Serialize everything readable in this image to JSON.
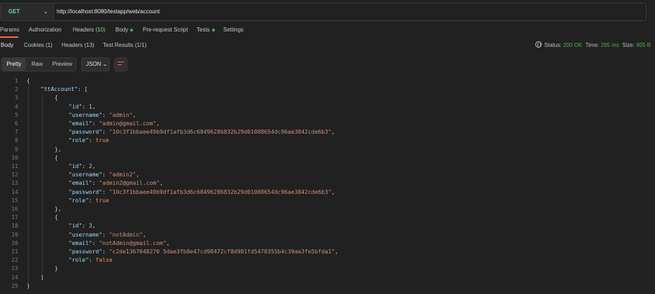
{
  "request": {
    "method": "GET",
    "url": "http://localhost:8080/testapp/web/account"
  },
  "request_tabs": [
    {
      "label": "Params",
      "count": ""
    },
    {
      "label": "Authorization",
      "count": ""
    },
    {
      "label": "Headers",
      "count": "(10)"
    },
    {
      "label": "Body",
      "count": ""
    },
    {
      "label": "Pre-request Script",
      "count": ""
    },
    {
      "label": "Tests",
      "count": ""
    },
    {
      "label": "Settings",
      "count": ""
    }
  ],
  "response_tabs": [
    {
      "label": "Body",
      "count": ""
    },
    {
      "label": "Cookies",
      "count": "(1)"
    },
    {
      "label": "Headers",
      "count": "(13)"
    },
    {
      "label": "Test Results",
      "count": "(1/1)"
    }
  ],
  "status": {
    "status_label": "Status:",
    "status_value": "200 OK",
    "time_label": "Time:",
    "time_value": "265 ms",
    "size_label": "Size:",
    "size_value": "905 B"
  },
  "view": {
    "pretty": "Pretty",
    "raw": "Raw",
    "preview": "Preview",
    "format": "JSON"
  },
  "colors": {
    "accent": "#ff6c37",
    "key": "#9cdcfe",
    "string": "#ce9178",
    "number": "#b5cea8",
    "ok": "#4caf50"
  },
  "code_lines": [
    {
      "n": "1",
      "indent": 0,
      "parts": [
        [
          "p",
          "{"
        ]
      ]
    },
    {
      "n": "2",
      "indent": 1,
      "parts": [
        [
          "k",
          "\"ttAccount\""
        ],
        [
          "p",
          ": ["
        ]
      ]
    },
    {
      "n": "3",
      "indent": 2,
      "parts": [
        [
          "p",
          "{"
        ]
      ]
    },
    {
      "n": "4",
      "indent": 3,
      "parts": [
        [
          "k",
          "\"id\""
        ],
        [
          "p",
          ": "
        ],
        [
          "n",
          "1"
        ],
        [
          "p",
          ","
        ]
      ]
    },
    {
      "n": "5",
      "indent": 3,
      "parts": [
        [
          "k",
          "\"username\""
        ],
        [
          "p",
          ": "
        ],
        [
          "s",
          "\"admin\""
        ],
        [
          "p",
          ","
        ]
      ]
    },
    {
      "n": "6",
      "indent": 3,
      "parts": [
        [
          "k",
          "\"email\""
        ],
        [
          "p",
          ": "
        ],
        [
          "s",
          "\"admin@gmail.com\""
        ],
        [
          "p",
          ","
        ]
      ]
    },
    {
      "n": "7",
      "indent": 3,
      "parts": [
        [
          "k",
          "\"password\""
        ],
        [
          "p",
          ": "
        ],
        [
          "s",
          "\"10c3f1bbaee49b9df1afb3d6c68496286832b29d01008654dc96ae3842cde6b3\""
        ],
        [
          "p",
          ","
        ]
      ]
    },
    {
      "n": "8",
      "indent": 3,
      "parts": [
        [
          "k",
          "\"role\""
        ],
        [
          "p",
          ": "
        ],
        [
          "b",
          "true"
        ]
      ]
    },
    {
      "n": "9",
      "indent": 2,
      "parts": [
        [
          "p",
          "},"
        ]
      ]
    },
    {
      "n": "10",
      "indent": 2,
      "parts": [
        [
          "p",
          "{"
        ]
      ]
    },
    {
      "n": "11",
      "indent": 3,
      "parts": [
        [
          "k",
          "\"id\""
        ],
        [
          "p",
          ": "
        ],
        [
          "n",
          "2"
        ],
        [
          "p",
          ","
        ]
      ]
    },
    {
      "n": "12",
      "indent": 3,
      "parts": [
        [
          "k",
          "\"username\""
        ],
        [
          "p",
          ": "
        ],
        [
          "s",
          "\"admin2\""
        ],
        [
          "p",
          ","
        ]
      ]
    },
    {
      "n": "13",
      "indent": 3,
      "parts": [
        [
          "k",
          "\"email\""
        ],
        [
          "p",
          ": "
        ],
        [
          "s",
          "\"admin2@gmail.com\""
        ],
        [
          "p",
          ","
        ]
      ]
    },
    {
      "n": "14",
      "indent": 3,
      "parts": [
        [
          "k",
          "\"password\""
        ],
        [
          "p",
          ": "
        ],
        [
          "s",
          "\"10c3f1bbaee49b9df1afb3d6c68496286832b29d01008654dc96ae3842cde6b3\""
        ],
        [
          "p",
          ","
        ]
      ]
    },
    {
      "n": "15",
      "indent": 3,
      "parts": [
        [
          "k",
          "\"role\""
        ],
        [
          "p",
          ": "
        ],
        [
          "b",
          "true"
        ]
      ]
    },
    {
      "n": "16",
      "indent": 2,
      "parts": [
        [
          "p",
          "},"
        ]
      ]
    },
    {
      "n": "17",
      "indent": 2,
      "parts": [
        [
          "p",
          "{"
        ]
      ]
    },
    {
      "n": "18",
      "indent": 3,
      "parts": [
        [
          "k",
          "\"id\""
        ],
        [
          "p",
          ": "
        ],
        [
          "n",
          "3"
        ],
        [
          "p",
          ","
        ]
      ]
    },
    {
      "n": "19",
      "indent": 3,
      "parts": [
        [
          "k",
          "\"username\""
        ],
        [
          "p",
          ": "
        ],
        [
          "s",
          "\"notAdmin\""
        ],
        [
          "p",
          ","
        ]
      ]
    },
    {
      "n": "20",
      "indent": 3,
      "parts": [
        [
          "k",
          "\"email\""
        ],
        [
          "p",
          ": "
        ],
        [
          "s",
          "\"notAdmin@gmail.com\""
        ],
        [
          "p",
          ","
        ]
      ]
    },
    {
      "n": "21",
      "indent": 3,
      "parts": [
        [
          "k",
          "\"password\""
        ],
        [
          "p",
          ": "
        ],
        [
          "s",
          "\"c2de1367048270 5dae3fb8e47cd98472cf8d981fd5470355b4c39aa3fe5bfda1\""
        ],
        [
          "p",
          ","
        ]
      ]
    },
    {
      "n": "22",
      "indent": 3,
      "parts": [
        [
          "k",
          "\"role\""
        ],
        [
          "p",
          ": "
        ],
        [
          "b",
          "false"
        ]
      ]
    },
    {
      "n": "23",
      "indent": 2,
      "parts": [
        [
          "p",
          "}"
        ]
      ]
    },
    {
      "n": "24",
      "indent": 1,
      "parts": [
        [
          "p",
          "]"
        ]
      ]
    },
    {
      "n": "25",
      "indent": 0,
      "parts": [
        [
          "p",
          "}"
        ]
      ]
    }
  ]
}
